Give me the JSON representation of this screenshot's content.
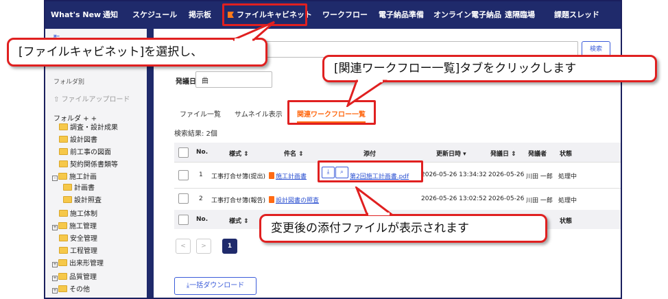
{
  "nav": {
    "items": [
      "What's New",
      "通知",
      "スケジュール",
      "掲示板",
      "ファイルキャビネット",
      "ワークフロー",
      "電子納品準備",
      "オンライン電子納品",
      "遠隔臨場",
      "課題スレッド"
    ]
  },
  "sidebar": {
    "folder_section": "フォルダ別",
    "upload_label": "ファイルアップロード",
    "folder_heading": "フォルダ",
    "folder_controls": "+ +",
    "tree": [
      "調査・設計成果",
      "設計図書",
      "前工事の図面",
      "契約関係書類等",
      "施工計画",
      "計画書",
      "設計照査",
      "施工体制",
      "施工管理",
      "安全管理",
      "工程管理",
      "出来形管理",
      "品質管理",
      "その他"
    ]
  },
  "search": {
    "button_label": "検索",
    "date_label": "発議日",
    "date_icon": "calendar-icon"
  },
  "tabs": [
    "ファイル一覧",
    "サムネイル表示",
    "関連ワークフロー一覧"
  ],
  "result_text": "検索結果: 2個",
  "table": {
    "headers": [
      "No.",
      "様式",
      "件名",
      "添付",
      "更新日時",
      "発議日",
      "発議者",
      "状態"
    ],
    "rows": [
      {
        "no": "1",
        "form": "工事打合せ簿(提出)",
        "subject": "施工計画書",
        "attachment": "第2回施工計画書.pdf",
        "updated": "2026-05-26 13:34:32",
        "issued": "2026-05-26",
        "issuer": "川田 一郎",
        "status": "処理中"
      },
      {
        "no": "2",
        "form": "工事打合せ簿(報告)",
        "subject": "設計図書の照査",
        "attachment": "",
        "updated": "2026-05-26 13:02:52",
        "issued": "2026-05-26",
        "issuer": "川田 一郎",
        "status": "処理中"
      }
    ]
  },
  "pagination": {
    "prev": "<",
    "next": ">",
    "current": "1"
  },
  "download_button": "一括ダウンロード",
  "callouts": {
    "select_cabinet": "[ファイルキャビネット]を選択し、",
    "click_tab": "[関連ワークフロー一覧]タブをクリックします",
    "attachment_shown": "変更後の添付ファイルが表示されます"
  },
  "colors": {
    "nav_bg": "#1f2a6b",
    "accent": "#ff6a13",
    "highlight": "#e02020",
    "link": "#2a4fd0"
  }
}
